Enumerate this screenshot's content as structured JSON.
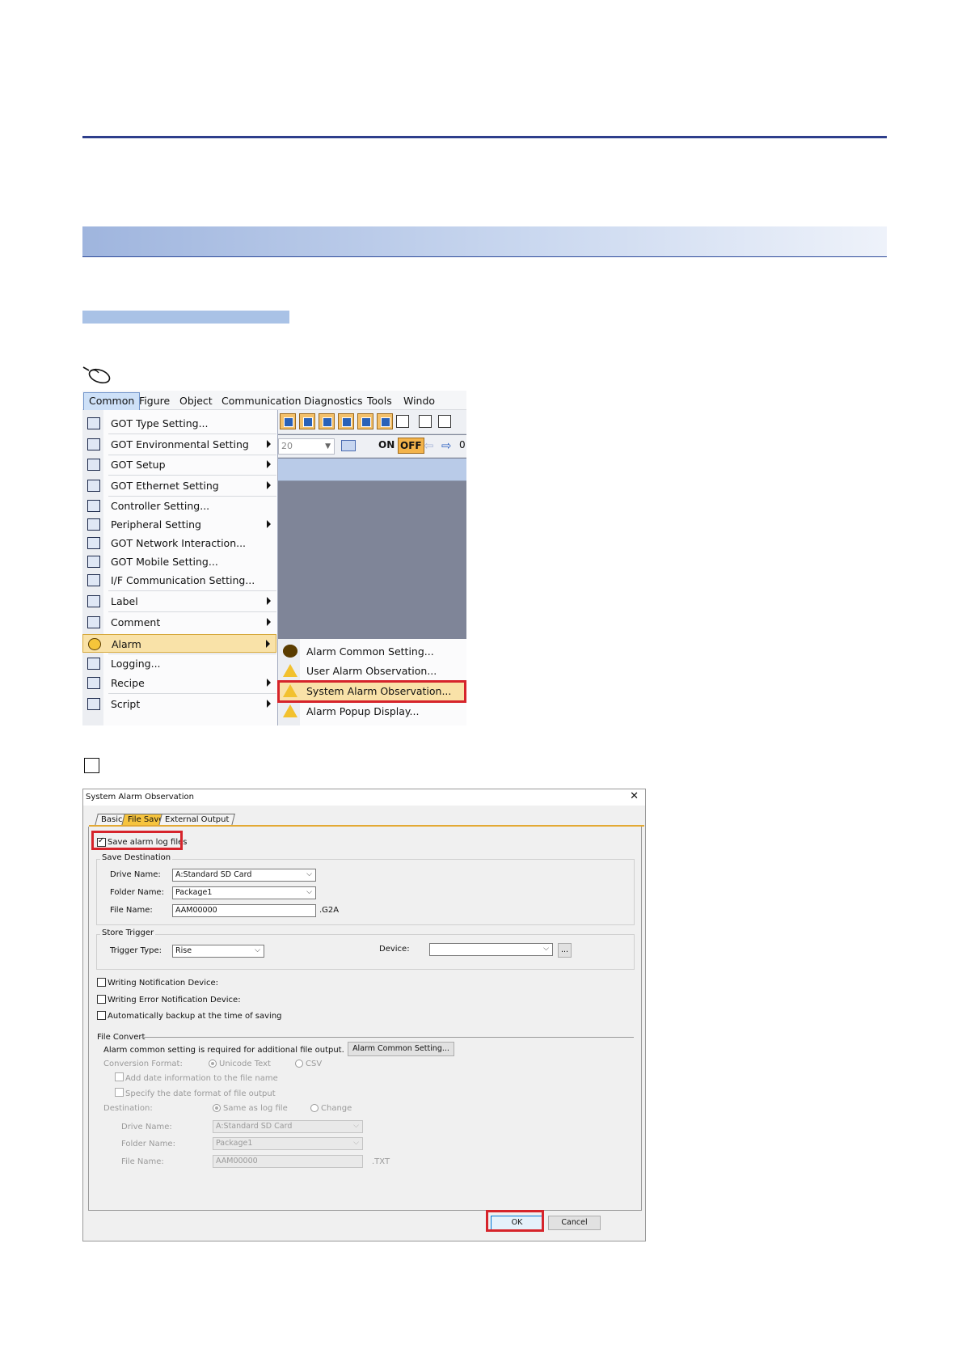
{
  "menu_screenshot": {
    "menubar": [
      "Common",
      "Figure",
      "Object",
      "Communication",
      "Diagnostics",
      "Tools",
      "Windo"
    ],
    "toolbar": {
      "zoom_value": "20",
      "on_label": "ON",
      "off_label": "OFF",
      "tail": "0"
    },
    "common_menu_items": [
      {
        "label": "GOT Type Setting...",
        "submenu": false,
        "icon": "got-type-icon"
      },
      {
        "label": "GOT Environmental Setting",
        "submenu": true,
        "icon": "got-environment-icon"
      },
      {
        "label": "GOT Setup",
        "submenu": true,
        "icon": "got-setup-icon"
      },
      {
        "label": "GOT Ethernet Setting",
        "submenu": true,
        "icon": "got-ethernet-icon"
      },
      {
        "label": "Controller Setting...",
        "submenu": false,
        "icon": "controller-icon"
      },
      {
        "label": "Peripheral Setting",
        "submenu": true,
        "icon": "peripheral-icon"
      },
      {
        "label": "GOT Network Interaction...",
        "submenu": false,
        "icon": "network-icon"
      },
      {
        "label": "GOT Mobile Setting...",
        "submenu": false,
        "icon": "mobile-icon"
      },
      {
        "label": "I/F Communication Setting...",
        "submenu": false,
        "icon": "if-communication-icon"
      },
      {
        "label": "Label",
        "submenu": true,
        "icon": "label-icon"
      },
      {
        "label": "Comment",
        "submenu": true,
        "icon": "comment-icon"
      },
      {
        "label": "Alarm",
        "submenu": true,
        "icon": "alarm-icon",
        "selected": true
      },
      {
        "label": "Logging...",
        "submenu": false,
        "icon": "logging-icon"
      },
      {
        "label": "Recipe",
        "submenu": true,
        "icon": "recipe-icon"
      },
      {
        "label": "Script",
        "submenu": true,
        "icon": "script-icon"
      }
    ],
    "alarm_submenu": [
      {
        "label": "Alarm Common Setting...",
        "icon": "alarm-common-icon"
      },
      {
        "label": "User Alarm Observation...",
        "icon": "user-alarm-icon"
      },
      {
        "label": "System Alarm Observation...",
        "icon": "system-alarm-icon",
        "selected": true
      },
      {
        "label": "Alarm Popup Display...",
        "icon": "alarm-popup-icon"
      }
    ]
  },
  "dialog": {
    "title": "System Alarm Observation",
    "close_glyph": "✕",
    "tabs": [
      "Basic",
      "File Save",
      "External Output"
    ],
    "active_tab": "File Save",
    "save_alarm_log_files": {
      "label": "Save alarm log files",
      "checked": true
    },
    "save_destination": {
      "title": "Save Destination",
      "drive_label": "Drive Name:",
      "drive_value": "A:Standard SD Card",
      "folder_label": "Folder Name:",
      "folder_value": "Package1",
      "file_label": "File Name:",
      "file_value": "AAM00000",
      "file_ext": ".G2A"
    },
    "store_trigger": {
      "title": "Store Trigger",
      "trigger_label": "Trigger Type:",
      "trigger_value": "Rise",
      "device_label": "Device:",
      "device_value": "",
      "browse_label": "..."
    },
    "checks": [
      {
        "label": "Writing Notification Device:",
        "checked": false
      },
      {
        "label": "Writing Error Notification Device:",
        "checked": false
      },
      {
        "label": "Automatically backup at the time of saving",
        "checked": false
      }
    ],
    "file_convert": {
      "title": "File Convert",
      "note": "Alarm common setting is required for additional file output.",
      "alarm_common_button": "Alarm Common Setting...",
      "conversion_label": "Conversion Format:",
      "format_unicode": "Unicode Text",
      "format_csv": "CSV",
      "add_date": "Add date information to the file name",
      "specify_date": "Specify the date format of file output",
      "destination_label": "Destination:",
      "dest_same": "Same as log file",
      "dest_change": "Change",
      "drive_label": "Drive Name:",
      "drive_value": "A:Standard SD Card",
      "folder_label": "Folder Name:",
      "folder_value": "Package1",
      "file_label": "File Name:",
      "file_value": "AAM00000",
      "file_ext": ".TXT"
    },
    "ok_label": "OK",
    "cancel_label": "Cancel"
  }
}
